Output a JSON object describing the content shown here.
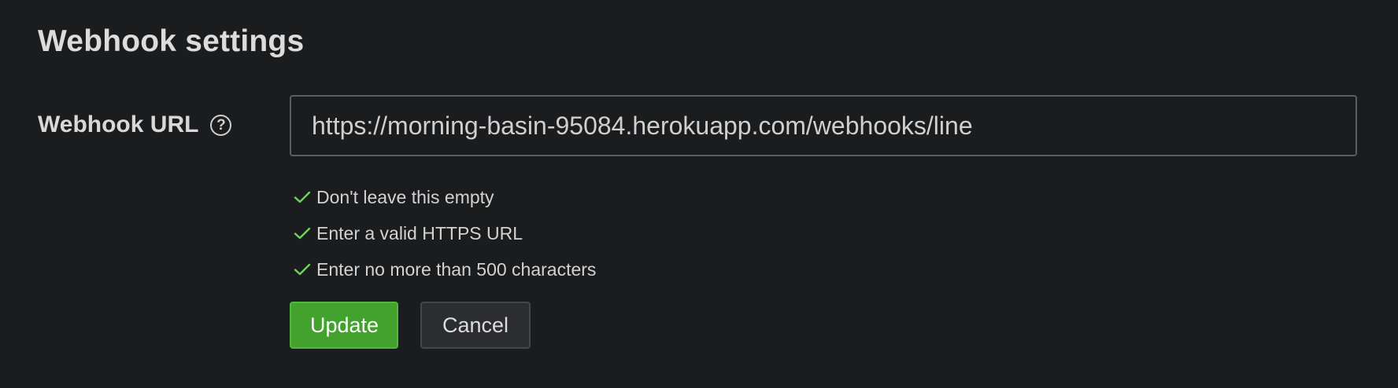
{
  "page": {
    "title": "Webhook settings"
  },
  "field": {
    "label": "Webhook URL",
    "help_icon": "question-circle-icon",
    "help_glyph": "?",
    "value": "https://morning-basin-95084.herokuapp.com/webhooks/line"
  },
  "validation": {
    "icon": "check-icon",
    "color": "#6fd35a",
    "rules": [
      {
        "text": "Don't leave this empty"
      },
      {
        "text": "Enter a valid HTTPS URL"
      },
      {
        "text": "Enter no more than 500 characters"
      }
    ]
  },
  "actions": {
    "update_label": "Update",
    "cancel_label": "Cancel"
  },
  "colors": {
    "background": "#1b1c1e",
    "primary_button": "#43a12e",
    "secondary_button": "#2c2d30"
  }
}
